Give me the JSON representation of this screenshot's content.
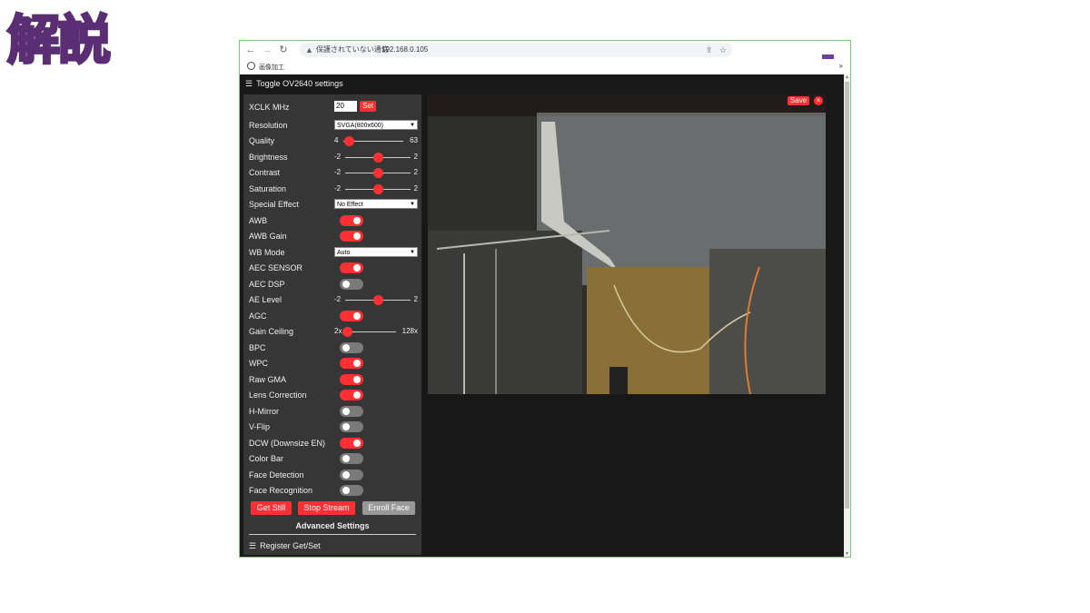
{
  "overlay": {
    "title": "解説"
  },
  "browser": {
    "address": {
      "security_text": "保護されていない通信",
      "url": "192.168.0.105"
    },
    "bookmark": {
      "label": "画像加工",
      "more": "»"
    }
  },
  "page": {
    "toggle_label": "Toggle OV2640 settings",
    "settings": {
      "xclk": {
        "label": "XCLK MHz",
        "value": "20",
        "button": "Set"
      },
      "resolution": {
        "label": "Resolution",
        "value": "SVGA(800x600)"
      },
      "quality": {
        "label": "Quality",
        "min": "4",
        "max": "63",
        "value": 10
      },
      "brightness": {
        "label": "Brightness",
        "min": "-2",
        "max": "2",
        "value": 0
      },
      "contrast": {
        "label": "Contrast",
        "min": "-2",
        "max": "2",
        "value": 0
      },
      "saturation": {
        "label": "Saturation",
        "min": "-2",
        "max": "2",
        "value": 0
      },
      "special_effect": {
        "label": "Special Effect",
        "value": "No Effect"
      },
      "awb": {
        "label": "AWB",
        "on": true
      },
      "awb_gain": {
        "label": "AWB Gain",
        "on": true
      },
      "wb_mode": {
        "label": "WB Mode",
        "value": "Auto"
      },
      "aec_sensor": {
        "label": "AEC SENSOR",
        "on": true
      },
      "aec_dsp": {
        "label": "AEC DSP",
        "on": false
      },
      "ae_level": {
        "label": "AE Level",
        "min": "-2",
        "max": "2",
        "value": 0
      },
      "agc": {
        "label": "AGC",
        "on": true
      },
      "gain_ceiling": {
        "label": "Gain Ceiling",
        "min": "2x",
        "max": "128x",
        "value": 0
      },
      "bpc": {
        "label": "BPC",
        "on": false
      },
      "wpc": {
        "label": "WPC",
        "on": true
      },
      "raw_gma": {
        "label": "Raw GMA",
        "on": true
      },
      "lens_correction": {
        "label": "Lens Correction",
        "on": true
      },
      "h_mirror": {
        "label": "H-Mirror",
        "on": false
      },
      "v_flip": {
        "label": "V-Flip",
        "on": false
      },
      "dcw": {
        "label": "DCW (Downsize EN)",
        "on": true
      },
      "color_bar": {
        "label": "Color Bar",
        "on": false
      },
      "face_detection": {
        "label": "Face Detection",
        "on": false
      },
      "face_recognition": {
        "label": "Face Recognition",
        "on": false
      }
    },
    "buttons": {
      "get_still": "Get Still",
      "stop_stream": "Stop Stream",
      "enroll_face": "Enroll Face"
    },
    "advanced_label": "Advanced Settings",
    "register_label": "Register Get/Set",
    "stream": {
      "save": "Save",
      "close": "×"
    }
  },
  "colors": {
    "accent": "#ff3034",
    "panel": "#363636",
    "background": "#181818"
  }
}
